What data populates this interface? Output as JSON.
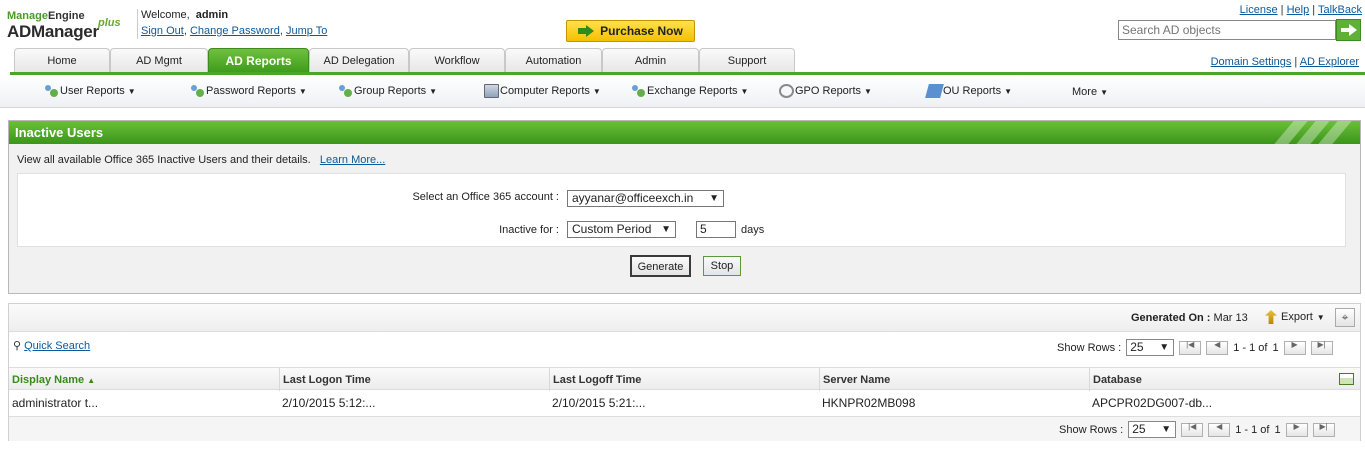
{
  "header": {
    "brand_top_a": "Manage",
    "brand_top_b": "Engine",
    "brand_main": "ADManager",
    "brand_plus": "plus",
    "welcome_label": "Welcome,",
    "username": "admin",
    "sign_out": "Sign Out",
    "change_password": "Change Password",
    "jump_to": "Jump To",
    "purchase_label": "Purchase Now",
    "license": "License",
    "help": "Help",
    "talkback": "TalkBack",
    "search_placeholder": "Search AD objects"
  },
  "tabs": [
    {
      "label": "Home"
    },
    {
      "label": "AD Mgmt"
    },
    {
      "label": "AD Reports"
    },
    {
      "label": "AD Delegation"
    },
    {
      "label": "Workflow"
    },
    {
      "label": "Automation"
    },
    {
      "label": "Admin"
    },
    {
      "label": "Support"
    }
  ],
  "right_links": {
    "domain_settings": "Domain Settings",
    "ad_explorer": "AD Explorer"
  },
  "submenu": [
    {
      "label": "User Reports",
      "icon": "users-icon"
    },
    {
      "label": "Password Reports",
      "icon": "users-icon"
    },
    {
      "label": "Group Reports",
      "icon": "users-icon"
    },
    {
      "label": "Computer Reports",
      "icon": "computer-icon"
    },
    {
      "label": "Exchange Reports",
      "icon": "users-icon"
    },
    {
      "label": "GPO Reports",
      "icon": "gpo-icon"
    },
    {
      "label": "OU Reports",
      "icon": "ou-icon"
    },
    {
      "label": "More",
      "icon": ""
    }
  ],
  "panel": {
    "title": "Inactive Users",
    "description": "View all available Office 365 Inactive Users and their details.",
    "learn_more": "Learn More...",
    "account_label": "Select an Office 365 account :",
    "account_value": "ayyanar@officeexch.in",
    "inactive_label": "Inactive for :",
    "period_value": "Custom Period",
    "days_value": "5",
    "days_label": "days",
    "generate": "Generate",
    "stop": "Stop"
  },
  "results": {
    "generated_label": "Generated On :",
    "generated_value": "Mar 13",
    "export": "Export",
    "quick_search": "Quick Search",
    "show_rows_label": "Show Rows :",
    "show_rows_value": "25",
    "page_info_top": "1 - 1 of",
    "page_total_top": "1",
    "page_info_bottom": "1 - 1 of",
    "page_total_bottom": "1",
    "columns": [
      "Display Name",
      "Last Logon Time",
      "Last Logoff Time",
      "Server Name",
      "Database"
    ],
    "rows": [
      [
        "administrator t...",
        "2/10/2015 5:12:...",
        "2/10/2015 5:21:...",
        "HKNPR02MB098",
        "APCPR02DG007-db..."
      ]
    ]
  }
}
